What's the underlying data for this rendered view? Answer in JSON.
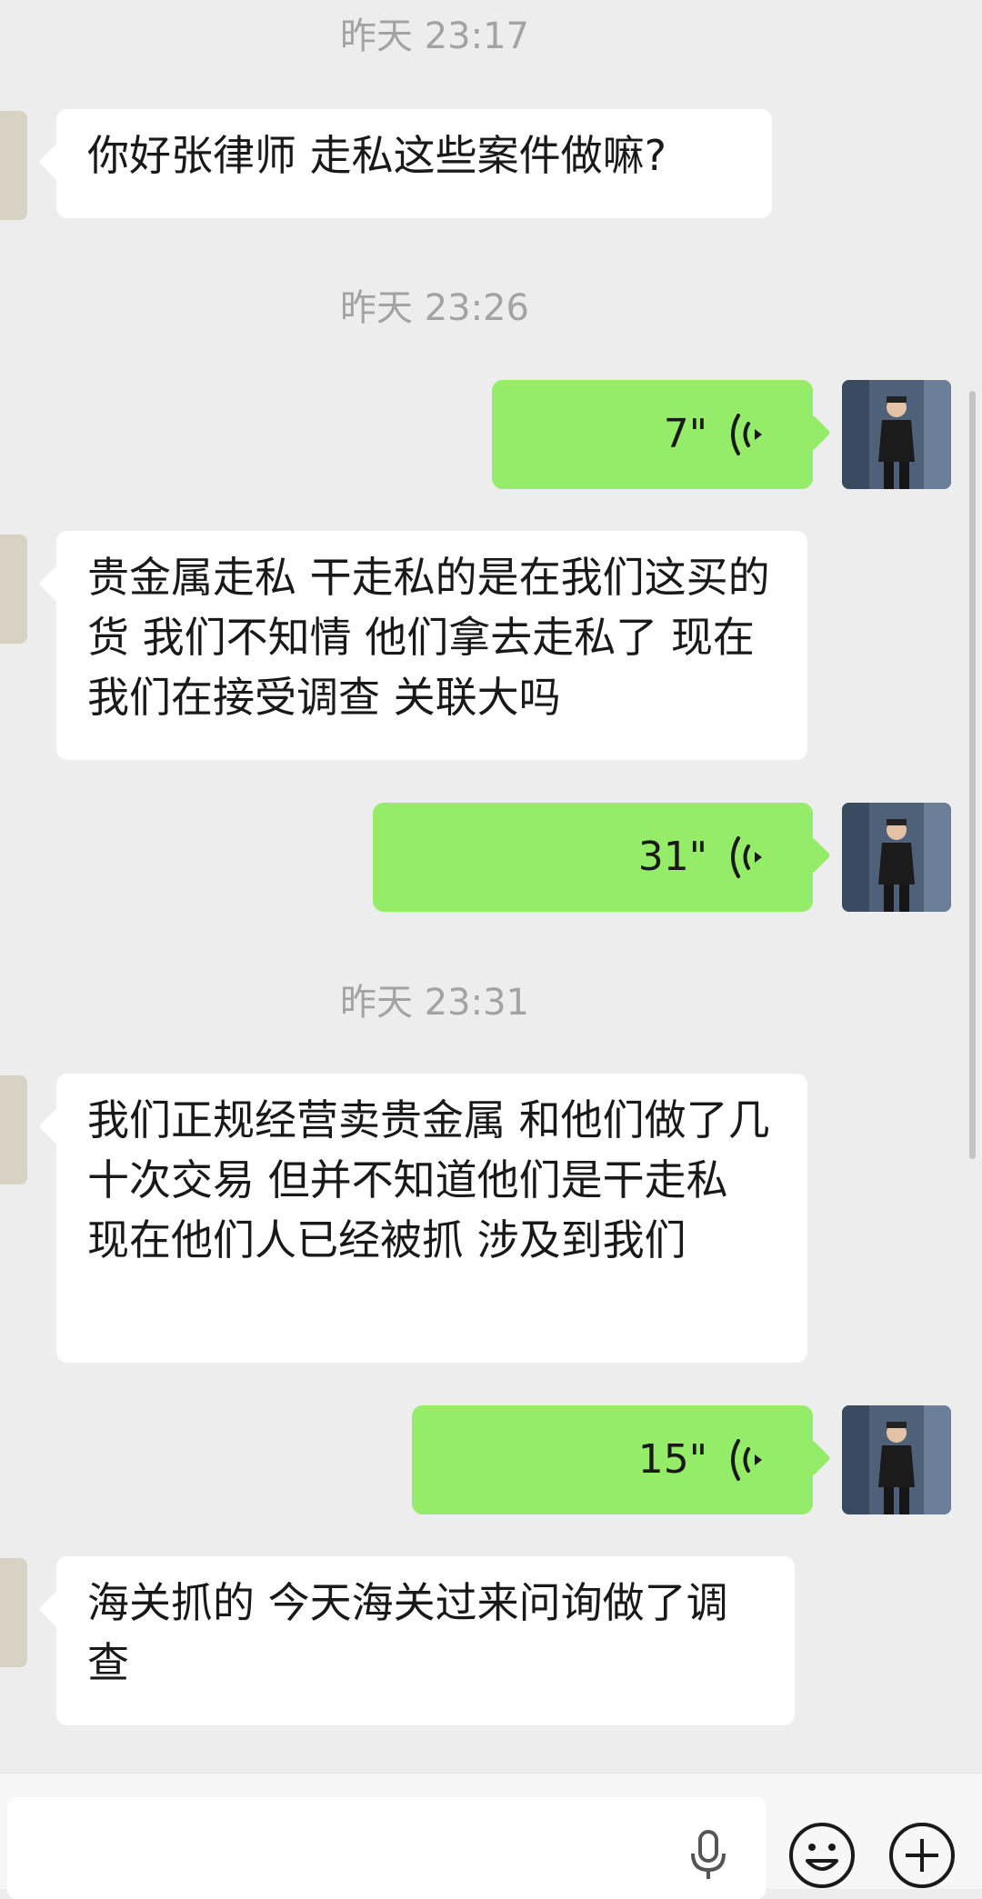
{
  "messages": {
    "ts1": "昨天 23:17",
    "m1": "你好张律师 走私这些案件做嘛?",
    "ts2": "昨天 23:26",
    "v1_duration": "7\"",
    "m2": "贵金属走私 干走私的是在我们这买的货 我们不知情 他们拿去走私了 现在我们在接受调查 关联大吗",
    "v2_duration": "31\"",
    "ts3": "昨天 23:31",
    "m3": "我们正规经营卖贵金属 和他们做了几十次交易 但并不知道他们是干走私 现在他们人已经被抓 涉及到我们",
    "v3_duration": "15\"",
    "m4": "海关抓的 今天海关过来问询做了调查"
  },
  "input_bar": {
    "text_value": "",
    "voice_icon": "microphone-icon",
    "emoji_icon": "smiley-face-icon",
    "more_icon": "plus-circle-icon"
  },
  "colors": {
    "background": "#ededed",
    "incoming_bubble": "#ffffff",
    "outgoing_bubble": "#95ec69",
    "timestamp_text": "#a3a3a3",
    "message_text": "#191919"
  }
}
